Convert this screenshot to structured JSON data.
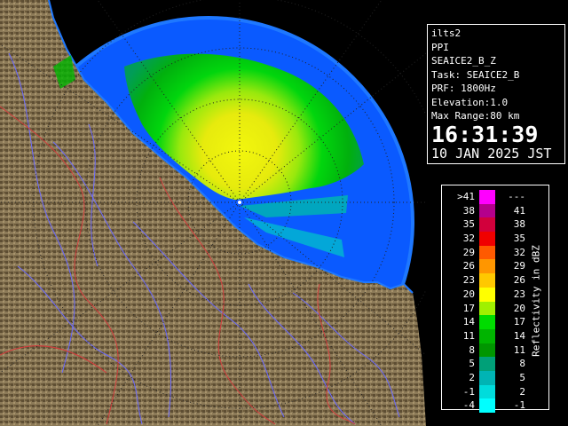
{
  "info": {
    "station": "ilts2",
    "mode": "PPI",
    "product": "SEAICE2_B_Z",
    "task": "Task: SEAICE2_B",
    "prf": "PRF: 1800Hz",
    "elevation": "Elevation:1.0",
    "max_range": "Max Range:80 km",
    "time": "16:31:39",
    "date": "10 JAN 2025 JST"
  },
  "legend": {
    "unit_label": "Reflectivity in dBZ",
    "rows": [
      {
        "min": ">41",
        "max": "---",
        "color": "#ff00ff"
      },
      {
        "min": "38",
        "max": "41",
        "color": "#b4008c"
      },
      {
        "min": "35",
        "max": "38",
        "color": "#d2003c"
      },
      {
        "min": "32",
        "max": "35",
        "color": "#f00000"
      },
      {
        "min": "29",
        "max": "32",
        "color": "#ff5a00"
      },
      {
        "min": "26",
        "max": "29",
        "color": "#ff9600"
      },
      {
        "min": "23",
        "max": "26",
        "color": "#ffc800"
      },
      {
        "min": "20",
        "max": "23",
        "color": "#ffff00"
      },
      {
        "min": "17",
        "max": "20",
        "color": "#a0f000"
      },
      {
        "min": "14",
        "max": "17",
        "color": "#00dc00"
      },
      {
        "min": "11",
        "max": "14",
        "color": "#00b400"
      },
      {
        "min": "8",
        "max": "11",
        "color": "#009600"
      },
      {
        "min": "5",
        "max": "8",
        "color": "#00a078"
      },
      {
        "min": "2",
        "max": "5",
        "color": "#00b4b4"
      },
      {
        "min": "-1",
        "max": "2",
        "color": "#00dcdc"
      },
      {
        "min": "-4",
        "max": "-1",
        "color": "#00ffff"
      }
    ]
  },
  "colors": {
    "sea": "#0a5aff",
    "sea_outer": "#1e78ff",
    "land": "#8c7a58",
    "river": "#6a6aff",
    "border": "#d23c3c"
  },
  "icons": {
    "radar": "radar-sweep-icon"
  }
}
